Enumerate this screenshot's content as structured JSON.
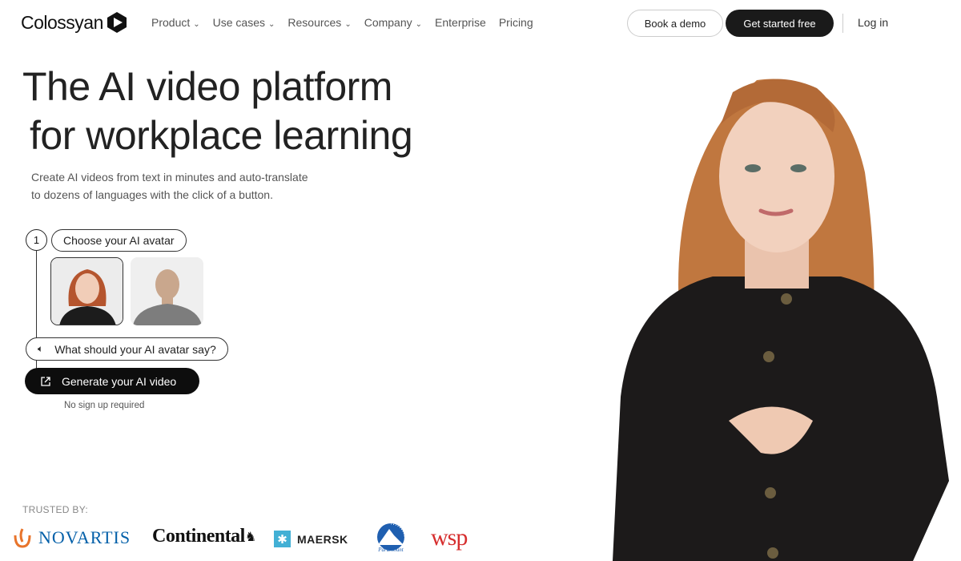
{
  "nav": {
    "brand": "Colossyan",
    "menu": [
      {
        "label": "Product",
        "dropdown": true
      },
      {
        "label": "Use cases",
        "dropdown": true
      },
      {
        "label": "Resources",
        "dropdown": true
      },
      {
        "label": "Company",
        "dropdown": true
      },
      {
        "label": "Enterprise",
        "dropdown": false
      },
      {
        "label": "Pricing",
        "dropdown": false
      }
    ],
    "book_demo": "Book a demo",
    "get_started": "Get started free",
    "login": "Log in"
  },
  "hero": {
    "title_line1": "The AI video platform",
    "title_line2": "for workplace learning",
    "subtitle_line1": "Create AI videos from text in minutes and auto-translate",
    "subtitle_line2": "to dozens of languages with the click of a button."
  },
  "builder": {
    "step_number": "1",
    "choose_label": "Choose your AI avatar",
    "avatars": [
      {
        "name": "female-avatar",
        "selected": true
      },
      {
        "name": "male-avatar",
        "selected": false
      }
    ],
    "say_placeholder": "What should your AI avatar say?",
    "generate_label": "Generate your AI video",
    "note": "No sign up required"
  },
  "trusted": {
    "label": "TRUSTED BY:",
    "logos": [
      "NOVARTIS",
      "Continental",
      "MAERSK",
      "Paramount",
      "wsp"
    ]
  },
  "colors": {
    "primary": "#0d0d0d",
    "novartis": "#0460a9",
    "wsp": "#d62e2e",
    "maersk": "#42b0d5"
  }
}
